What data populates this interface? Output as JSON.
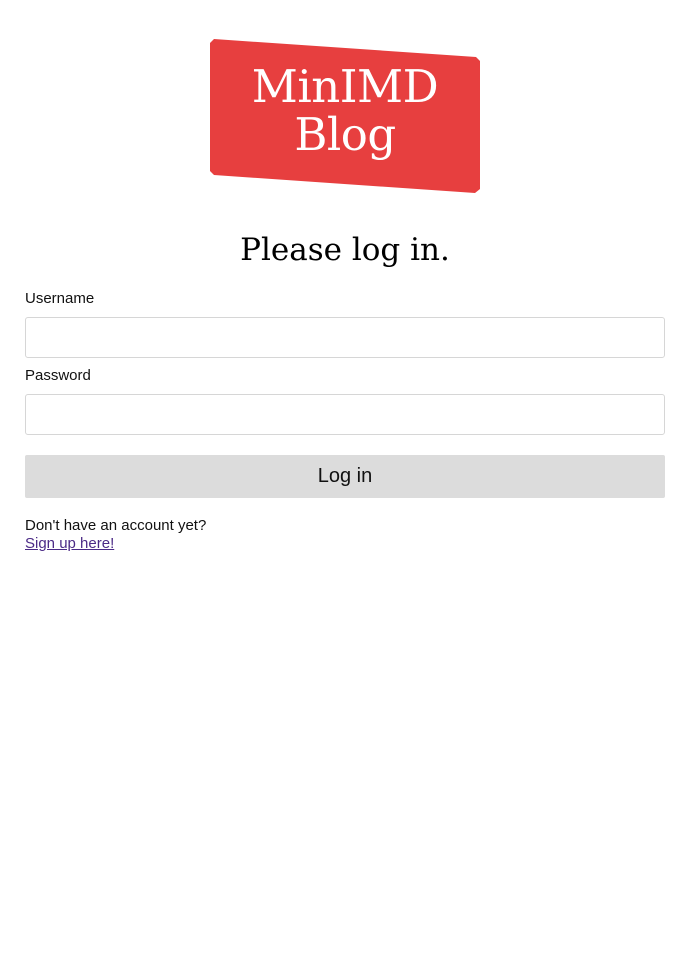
{
  "logo": {
    "line1": "MinIMD",
    "line2": "Blog",
    "color": "#e73f3f"
  },
  "page_title": "Please log in.",
  "form": {
    "username_label": "Username",
    "username_value": "",
    "password_label": "Password",
    "password_value": "",
    "submit_label": "Log in"
  },
  "signup": {
    "prompt": "Don't have an account yet?",
    "link_label": "Sign up here!"
  },
  "colors": {
    "button_bg": "#dcdcdc",
    "link": "#4b2a86"
  }
}
